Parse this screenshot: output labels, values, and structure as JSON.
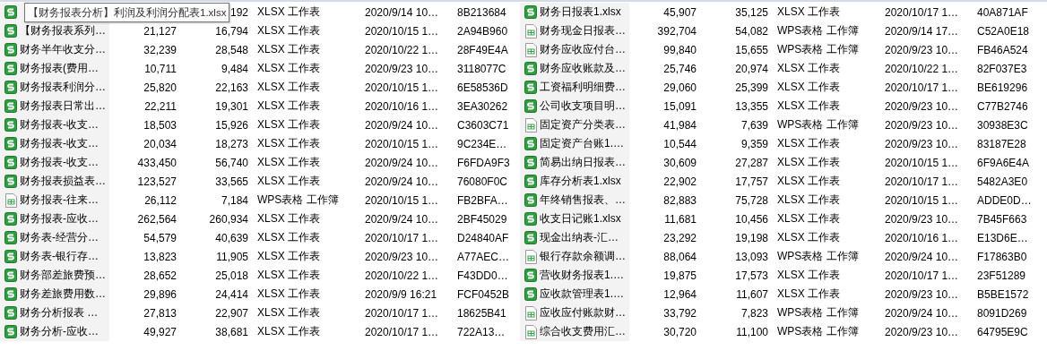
{
  "tooltip": "【财务报表分析】利润及利润分配表1.xlsx",
  "panes": [
    {
      "rows": [
        {
          "kind": "xlsx",
          "packed": "192",
          "type": "XLSX 工作表",
          "modified": "2020/9/14 10…",
          "crc": "8B213684"
        },
        {
          "kind": "xlsx",
          "name": "【财务报表系列…",
          "size": "21,127",
          "packed": "16,794",
          "type": "XLSX 工作表",
          "modified": "2020/10/15 1…",
          "crc": "2A94B960"
        },
        {
          "kind": "xlsx",
          "name": "财务半年收支分…",
          "size": "32,239",
          "packed": "28,548",
          "type": "XLSX 工作表",
          "modified": "2020/10/22 1…",
          "crc": "28F49E4A"
        },
        {
          "kind": "xlsx",
          "name": "财务报表(费用…",
          "size": "10,711",
          "packed": "9,484",
          "type": "XLSX 工作表",
          "modified": "2020/9/23 10…",
          "crc": "3118077C"
        },
        {
          "kind": "xlsx",
          "name": "财务报表利润分…",
          "size": "25,820",
          "packed": "22,163",
          "type": "XLSX 工作表",
          "modified": "2020/10/15 1…",
          "crc": "6E58536D"
        },
        {
          "kind": "xlsx",
          "name": "财务报表日常出…",
          "size": "22,211",
          "packed": "19,301",
          "type": "XLSX 工作表",
          "modified": "2020/10/16 1…",
          "crc": "3EA30262"
        },
        {
          "kind": "xlsx",
          "name": "财务报表-收支…",
          "size": "18,503",
          "packed": "15,926",
          "type": "XLSX 工作表",
          "modified": "2020/9/24 10…",
          "crc": "C3603C71"
        },
        {
          "kind": "xlsx",
          "name": "财务报表-收支…",
          "size": "20,034",
          "packed": "18,273",
          "type": "XLSX 工作表",
          "modified": "2020/10/15 1…",
          "crc": "9C234E…"
        },
        {
          "kind": "xlsx",
          "name": "财务报表-收支…",
          "size": "433,450",
          "packed": "56,740",
          "type": "XLSX 工作表",
          "modified": "2020/9/24 10…",
          "crc": "F6FDA9F3"
        },
        {
          "kind": "xlsx",
          "name": "财务报表损益表…",
          "size": "123,527",
          "packed": "33,565",
          "type": "XLSX 工作表",
          "modified": "2020/9/24 10…",
          "crc": "76080F0C"
        },
        {
          "kind": "wps",
          "name": "财务报表-往来…",
          "size": "26,112",
          "packed": "7,184",
          "type": "WPS表格 工作簿",
          "modified": "2020/10/15 1…",
          "crc": "FB2BFA…"
        },
        {
          "kind": "xlsx",
          "name": "财务报表-应收…",
          "size": "262,564",
          "packed": "260,934",
          "type": "XLSX 工作表",
          "modified": "2020/9/24 10…",
          "crc": "2BF45029"
        },
        {
          "kind": "xlsx",
          "name": "财务表-经营分…",
          "size": "54,579",
          "packed": "40,639",
          "type": "XLSX 工作表",
          "modified": "2020/10/17 1…",
          "crc": "D24840AF"
        },
        {
          "kind": "xlsx",
          "name": "财务表-银行存…",
          "size": "13,823",
          "packed": "11,905",
          "type": "XLSX 工作表",
          "modified": "2020/9/23 10…",
          "crc": "A77AEC…"
        },
        {
          "kind": "xlsx",
          "name": "财务部差旅费预…",
          "size": "28,652",
          "packed": "25,018",
          "type": "XLSX 工作表",
          "modified": "2020/10/22 1…",
          "crc": "F43DD0…"
        },
        {
          "kind": "xlsx",
          "name": "财务差旅费用数…",
          "size": "29,896",
          "packed": "24,414",
          "type": "XLSX 工作表",
          "modified": "2020/9/9 16:21",
          "crc": "FCF0452B"
        },
        {
          "kind": "xlsx",
          "name": "财务分析报表 …",
          "size": "27,813",
          "packed": "22,907",
          "type": "XLSX 工作表",
          "modified": "2020/10/17 1…",
          "crc": "18625B41"
        },
        {
          "kind": "xlsx",
          "name": "财务分析-应收…",
          "size": "49,927",
          "packed": "38,681",
          "type": "XLSX 工作表",
          "modified": "2020/10/17 1…",
          "crc": "722A13…"
        }
      ]
    },
    {
      "rows": [
        {
          "kind": "xlsx",
          "name": "财务日报表1.xlsx",
          "size": "45,907",
          "packed": "35,125",
          "type": "XLSX 工作表",
          "modified": "2020/10/17 1…",
          "crc": "40A871AF"
        },
        {
          "kind": "wps",
          "name": "财务现金日报表…",
          "size": "392,704",
          "packed": "54,082",
          "type": "WPS表格 工作簿",
          "modified": "2020/9/14 17…",
          "crc": "C52A0E18"
        },
        {
          "kind": "wps",
          "name": "财务应收应付台…",
          "size": "99,840",
          "packed": "15,655",
          "type": "WPS表格 工作簿",
          "modified": "2020/9/23 10…",
          "crc": "FB46A524"
        },
        {
          "kind": "xlsx",
          "name": "财务应收账款及…",
          "size": "25,746",
          "packed": "20,974",
          "type": "XLSX 工作表",
          "modified": "2020/10/22 1…",
          "crc": "82F037E3"
        },
        {
          "kind": "xlsx",
          "name": "工资福利明细费…",
          "size": "29,060",
          "packed": "25,399",
          "type": "XLSX 工作表",
          "modified": "2020/10/17 1…",
          "crc": "BE619296"
        },
        {
          "kind": "xlsx",
          "name": "公司收支项目明…",
          "size": "15,091",
          "packed": "13,355",
          "type": "XLSX 工作表",
          "modified": "2020/9/23 10…",
          "crc": "C77B2746"
        },
        {
          "kind": "wps",
          "name": "固定资产分类表…",
          "size": "41,984",
          "packed": "7,639",
          "type": "WPS表格 工作簿",
          "modified": "2020/9/23 10…",
          "crc": "30938E3C"
        },
        {
          "kind": "xlsx",
          "name": "固定资产台账1.…",
          "size": "10,544",
          "packed": "9,359",
          "type": "XLSX 工作表",
          "modified": "2020/9/23 10…",
          "crc": "83187E28"
        },
        {
          "kind": "xlsx",
          "name": "简易出纳日报表…",
          "size": "30,609",
          "packed": "27,287",
          "type": "XLSX 工作表",
          "modified": "2020/10/15 1…",
          "crc": "6F9A6E4A"
        },
        {
          "kind": "xlsx",
          "name": "库存分析表1.xlsx",
          "size": "22,902",
          "packed": "17,757",
          "type": "XLSX 工作表",
          "modified": "2020/10/17 1…",
          "crc": "5482A3E0"
        },
        {
          "kind": "xlsx",
          "name": "年终销售报表、…",
          "size": "82,883",
          "packed": "75,728",
          "type": "XLSX 工作表",
          "modified": "2020/10/15 1…",
          "crc": "ADDE0D…"
        },
        {
          "kind": "xlsx",
          "name": "收支日记账1.xlsx",
          "size": "11,681",
          "packed": "10,456",
          "type": "XLSX 工作表",
          "modified": "2020/9/23 10…",
          "crc": "7B45F663"
        },
        {
          "kind": "xlsx",
          "name": "现金出纳表-汇…",
          "size": "23,292",
          "packed": "19,198",
          "type": "XLSX 工作表",
          "modified": "2020/10/16 1…",
          "crc": "E13D6E…"
        },
        {
          "kind": "wps",
          "name": "银行存款余额调…",
          "size": "88,064",
          "packed": "13,093",
          "type": "WPS表格 工作簿",
          "modified": "2020/9/24 10…",
          "crc": "F17863B0"
        },
        {
          "kind": "xlsx",
          "name": "营收财务报表1.…",
          "size": "19,875",
          "packed": "17,573",
          "type": "XLSX 工作表",
          "modified": "2020/10/17 1…",
          "crc": "23F51289"
        },
        {
          "kind": "xlsx",
          "name": "应收款管理表1.…",
          "size": "12,964",
          "packed": "11,607",
          "type": "XLSX 工作表",
          "modified": "2020/9/23 10…",
          "crc": "B5BE1572"
        },
        {
          "kind": "wps",
          "name": "应收应付账款财…",
          "size": "33,792",
          "packed": "7,823",
          "type": "WPS表格 工作簿",
          "modified": "2020/9/24 10…",
          "crc": "8091D269"
        },
        {
          "kind": "wps",
          "name": "综合收支费用汇…",
          "size": "30,720",
          "packed": "11,100",
          "type": "WPS表格 工作簿",
          "modified": "2020/9/23 10…",
          "crc": "64795E9C"
        }
      ]
    }
  ]
}
